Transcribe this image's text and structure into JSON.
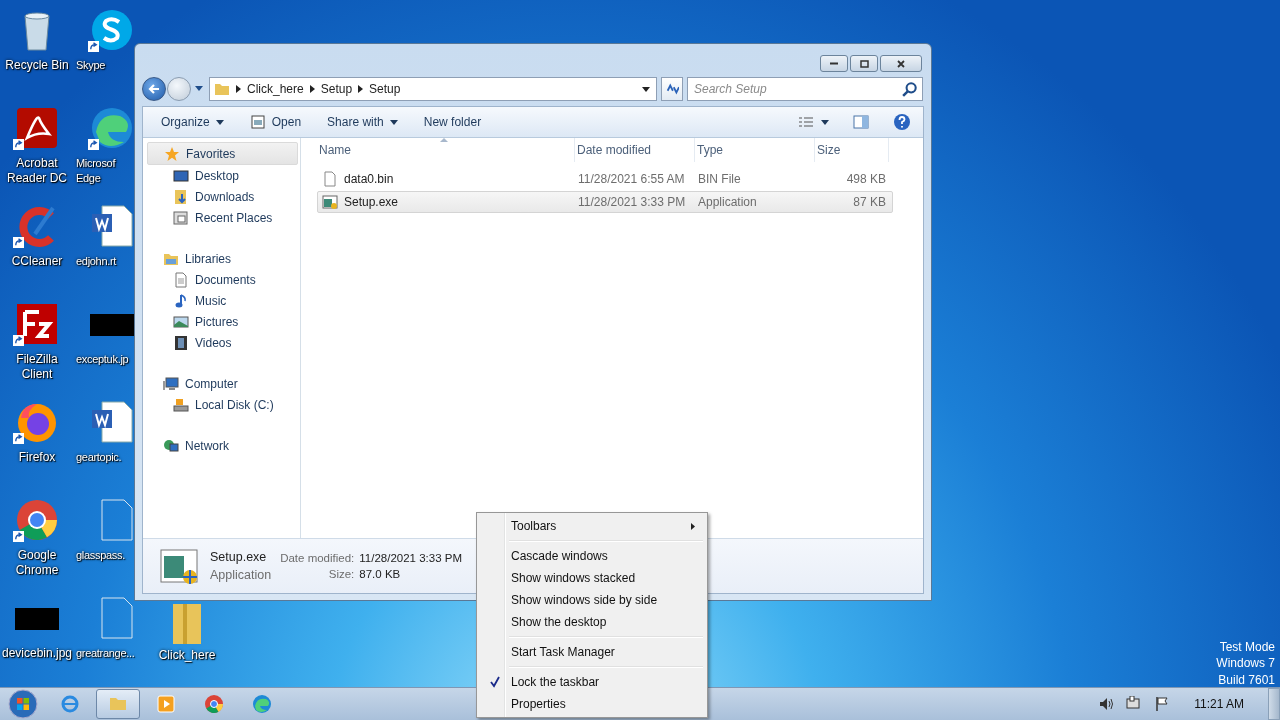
{
  "desktop": {
    "columns": [
      [
        {
          "label": "Recycle Bin",
          "kind": "recycle",
          "shortcut": false
        },
        {
          "label": "Acrobat Reader DC",
          "kind": "acrobat",
          "shortcut": true
        },
        {
          "label": "CCleaner",
          "kind": "ccleaner",
          "shortcut": true
        },
        {
          "label": "FileZilla Client",
          "kind": "filezilla",
          "shortcut": true
        },
        {
          "label": "Firefox",
          "kind": "firefox",
          "shortcut": true
        },
        {
          "label": "Google Chrome",
          "kind": "chrome",
          "shortcut": true
        },
        {
          "label": "devicebin.jpg",
          "kind": "redacted",
          "shortcut": false
        }
      ],
      [
        {
          "label": "Skype",
          "kind": "skype",
          "shortcut": true
        },
        {
          "label": "Microsof Edge",
          "kind": "edge",
          "shortcut": true
        },
        {
          "label": "edjohn.rt",
          "kind": "word",
          "shortcut": false
        },
        {
          "label": "exceptuk.jp",
          "kind": "redacted",
          "shortcut": false
        },
        {
          "label": "geartopic.",
          "kind": "word",
          "shortcut": false
        },
        {
          "label": "glasspass.",
          "kind": "blank",
          "shortcut": false
        },
        {
          "label": "greatrange...",
          "kind": "blank",
          "shortcut": false
        }
      ]
    ],
    "folder": {
      "label": "Click_here"
    },
    "watermark_lines": [
      "Test Mode",
      "Windows 7",
      "Build 7601"
    ]
  },
  "explorer": {
    "breadcrumb": [
      "Click_here",
      "Setup",
      "Setup"
    ],
    "search": {
      "placeholder": "Search Setup"
    },
    "toolbar": [
      {
        "label": "Organize",
        "kind": "dropdown"
      },
      {
        "label": "Open",
        "kind": "open"
      },
      {
        "label": "Share with",
        "kind": "dropdown"
      },
      {
        "label": "New folder",
        "kind": "plain"
      }
    ],
    "nav": [
      {
        "label": "Favorites",
        "kind": "favorites",
        "selected": true,
        "children": [
          {
            "label": "Desktop",
            "kind": "desktop",
            "selected": false
          },
          {
            "label": "Downloads",
            "kind": "downloads",
            "selected": false
          },
          {
            "label": "Recent Places",
            "kind": "recent",
            "selected": false
          }
        ]
      },
      {
        "label": "Libraries",
        "kind": "libraries",
        "selected": false,
        "children": [
          {
            "label": "Documents",
            "kind": "documents",
            "selected": false
          },
          {
            "label": "Music",
            "kind": "music",
            "selected": false
          },
          {
            "label": "Pictures",
            "kind": "pictures",
            "selected": false
          },
          {
            "label": "Videos",
            "kind": "videos",
            "selected": false
          }
        ]
      },
      {
        "label": "Computer",
        "kind": "computer",
        "selected": false,
        "children": [
          {
            "label": "Local Disk (C:)",
            "kind": "disk",
            "selected": false
          }
        ]
      },
      {
        "label": "Network",
        "kind": "network",
        "selected": false
      }
    ],
    "columns": [
      "Name",
      "Date modified",
      "Type",
      "Size"
    ],
    "files": [
      {
        "name": "data0.bin",
        "date": "11/28/2021 6:55 AM",
        "type": "BIN File",
        "size": "498 KB",
        "kind": "file",
        "selected": false
      },
      {
        "name": "Setup.exe",
        "date": "11/28/2021 3:33 PM",
        "type": "Application",
        "size": "87 KB",
        "kind": "app",
        "selected": true
      }
    ],
    "details": {
      "name": "Setup.exe",
      "type": "Application",
      "fields": [
        {
          "label": "Date modified:",
          "value": "11/28/2021 3:33 PM"
        },
        {
          "label": "Size:",
          "value": "87.0 KB"
        }
      ]
    }
  },
  "context_menu": {
    "groups": [
      [
        {
          "label": "Toolbars",
          "checked": false,
          "submenu": true
        }
      ],
      [
        {
          "label": "Cascade windows",
          "checked": false,
          "submenu": false
        },
        {
          "label": "Show windows stacked",
          "checked": false,
          "submenu": false
        },
        {
          "label": "Show windows side by side",
          "checked": false,
          "submenu": false
        },
        {
          "label": "Show the desktop",
          "checked": false,
          "submenu": false
        }
      ],
      [
        {
          "label": "Start Task Manager",
          "checked": false,
          "submenu": false
        }
      ],
      [
        {
          "label": "Lock the taskbar",
          "checked": true,
          "submenu": false
        },
        {
          "label": "Properties",
          "checked": false,
          "submenu": false
        }
      ]
    ]
  },
  "taskbar": {
    "apps": [
      {
        "kind": "ie",
        "active": false
      },
      {
        "kind": "explorer",
        "active": true
      },
      {
        "kind": "media",
        "active": false
      },
      {
        "kind": "chrome",
        "active": false
      },
      {
        "kind": "edge",
        "active": false
      }
    ],
    "clock": "11:21 AM"
  }
}
